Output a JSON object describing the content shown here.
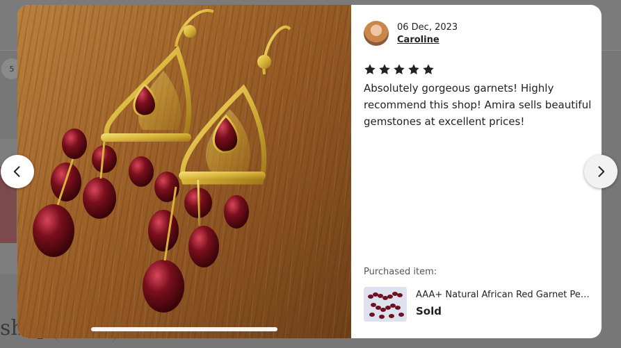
{
  "background": {
    "chip_text": "5",
    "shop_text": "shop"
  },
  "review": {
    "date": "06 Dec, 2023",
    "reviewer": "Caroline",
    "rating": 5,
    "text": "Absolutely gorgeous garnets! Highly recommend this shop! Amira sells beautiful gemstones at excellent prices!"
  },
  "purchase": {
    "label": "Purchased item:",
    "title": "AAA+ Natural African Red Garnet Pear...",
    "status": "Sold"
  },
  "icons": {
    "prev": "chevron-left-icon",
    "next": "chevron-right-icon",
    "star": "star-icon"
  },
  "colors": {
    "star": "#222222",
    "garnet": "#7a0f1c",
    "gold": "#d8b43a"
  }
}
